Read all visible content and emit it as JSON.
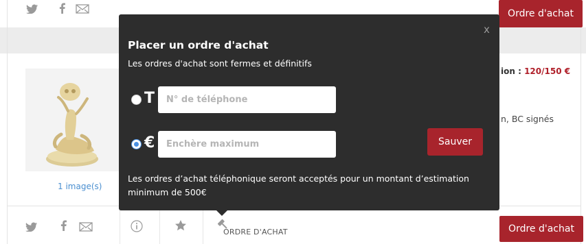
{
  "listing": {
    "top_buy_button": "Ordre d'achat",
    "image_count": "1 image(s)",
    "estimation_prefix": "ion : ",
    "estimation_value": "120/150 €",
    "description_fragment": "n, BC signés",
    "bottom_ordre_link": "ORDRE D'ACHAT",
    "bottom_buy_button": "Ordre d'achat"
  },
  "modal": {
    "close": "x",
    "title": "Placer un ordre d'achat",
    "subtitle": "Les ordres d'achat sont fermes et définitifs",
    "phone_option": {
      "icon_glyph": "T",
      "placeholder": "N° de téléphone",
      "selected": false
    },
    "bid_option": {
      "icon_glyph": "€",
      "placeholder": "Enchère maximum",
      "selected": true
    },
    "save_label": "Sauver",
    "note": "Les ordres d’achat téléphonique seront acceptés pour un montant d’estimation minimum de 500€"
  },
  "icons": {
    "twitter": "twitter-icon",
    "facebook": "facebook-icon",
    "mail": "mail-icon",
    "info": "info-icon",
    "star": "star-icon",
    "gavel": "gavel-icon"
  },
  "colors": {
    "accent_red": "#a8242c",
    "modal_bg": "#2d2d2d",
    "link_blue": "#4a8fd0",
    "radio_blue": "#4a90e2"
  }
}
